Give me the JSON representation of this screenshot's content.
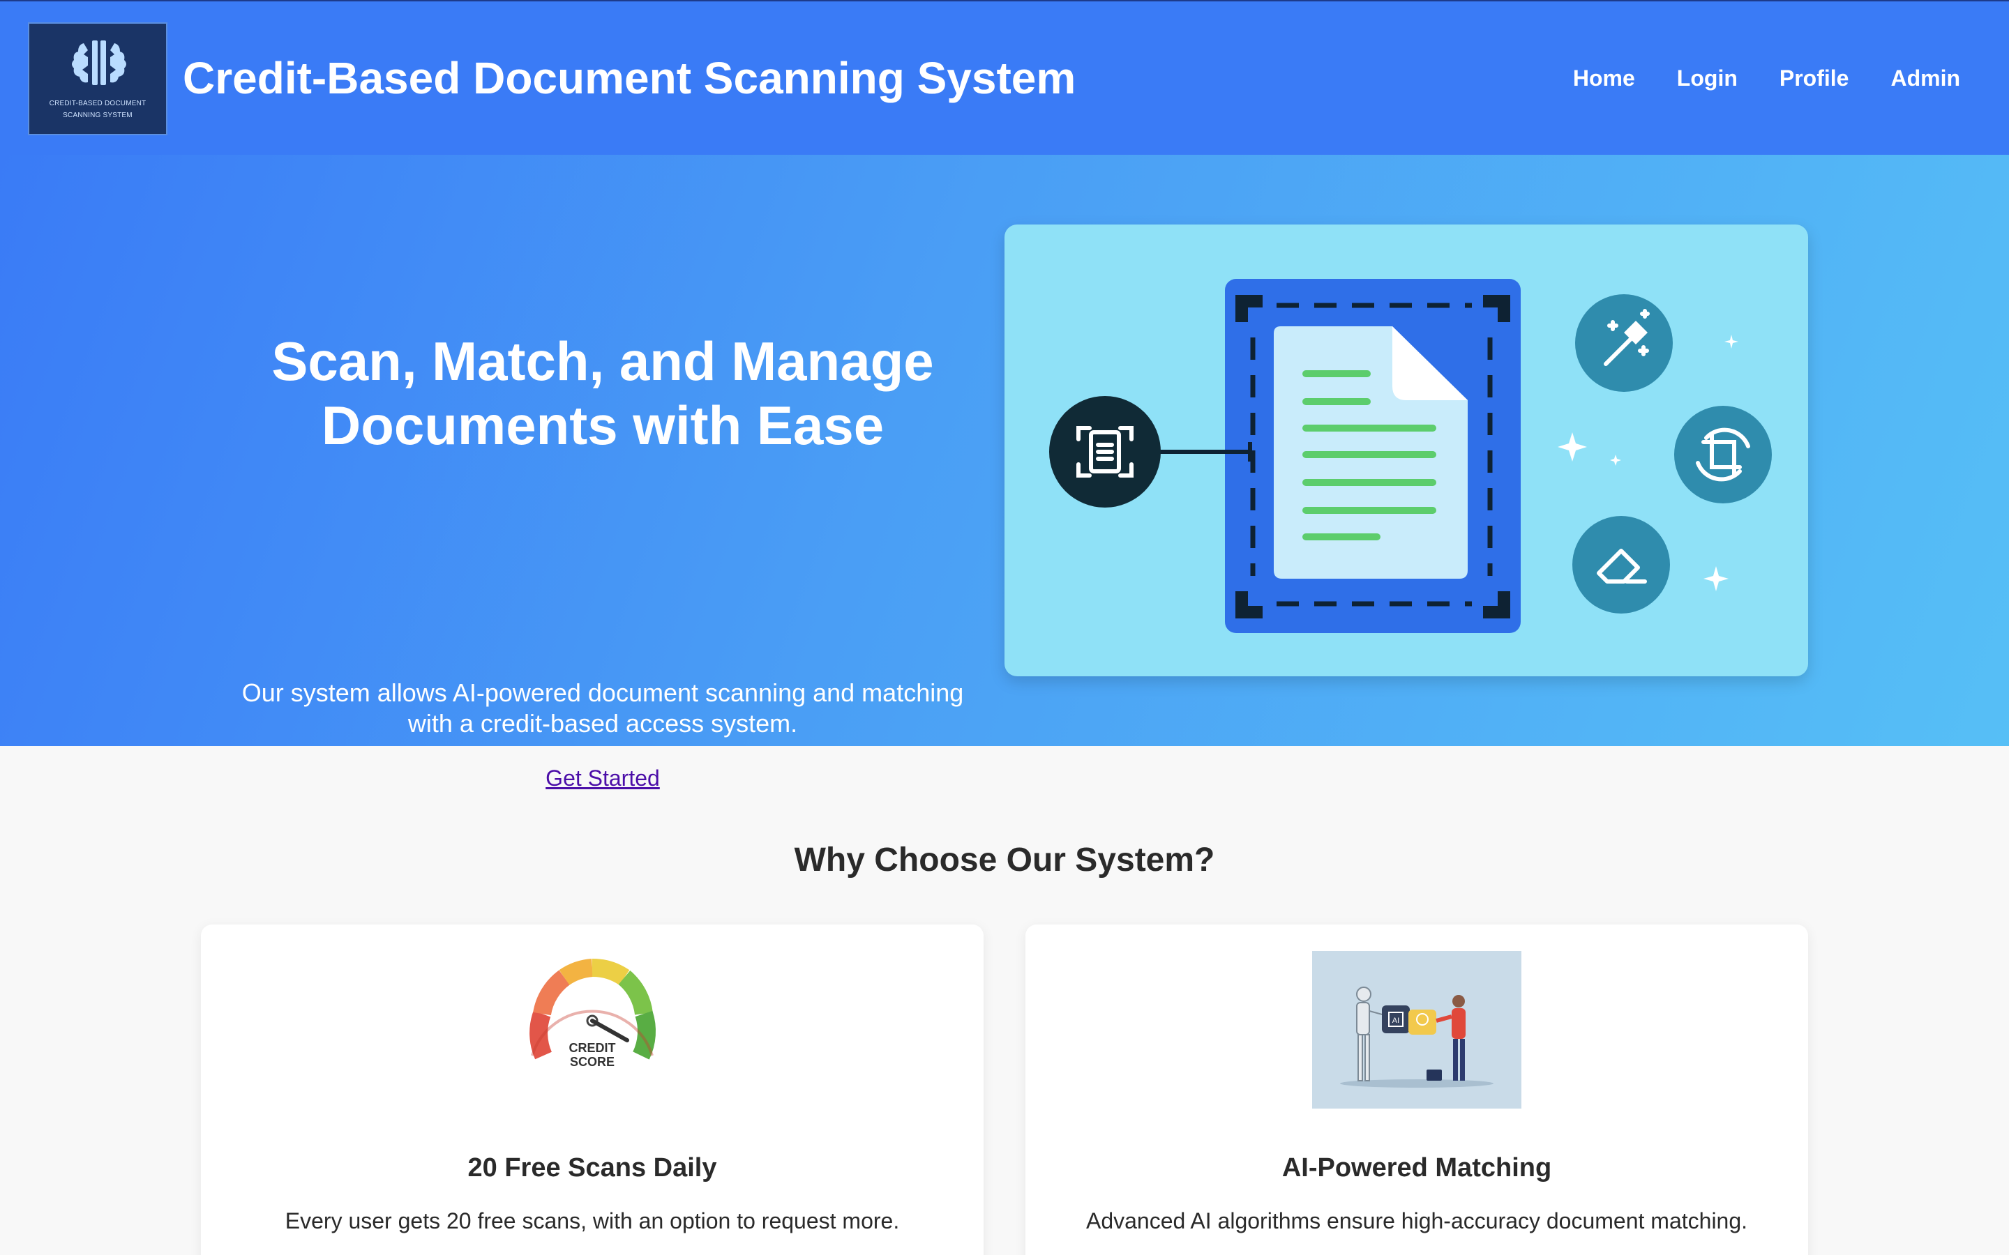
{
  "header": {
    "logo_text_line1": "CREDIT-BASED DOCUMENT",
    "logo_text_line2": "SCANNING SYSTEM",
    "title": "Credit-Based Document Scanning System",
    "nav": [
      "Home",
      "Login",
      "Profile",
      "Admin"
    ]
  },
  "hero": {
    "heading_line1": "Scan, Match, and Manage",
    "heading_line2": "Documents with Ease",
    "subtitle_line1": "Our system allows AI-powered document scanning and matching",
    "subtitle_line2": "with a credit-based access system.",
    "cta": "Get Started",
    "illustration_icons": [
      "scan-document-icon",
      "magic-wand-icon",
      "crop-rotate-icon",
      "eraser-icon",
      "sparkle-icon"
    ]
  },
  "features": {
    "title": "Why Choose Our System?",
    "cards": [
      {
        "title": "20 Free Scans Daily",
        "description": "Every user gets 20 free scans, with an option to request more.",
        "image_label_line1": "CREDIT",
        "image_label_line2": "SCORE"
      },
      {
        "title": "AI-Powered Matching",
        "description": "Advanced AI algorithms ensure high-accuracy document matching.",
        "image_label": "AI"
      }
    ]
  },
  "colors": {
    "header_bg": "#3a7bf6",
    "hero_gradient_start": "#3a7bf6",
    "hero_gradient_end": "#56bff6",
    "illustration_bg": "#8fe1f7",
    "link": "#4b0ea8"
  }
}
